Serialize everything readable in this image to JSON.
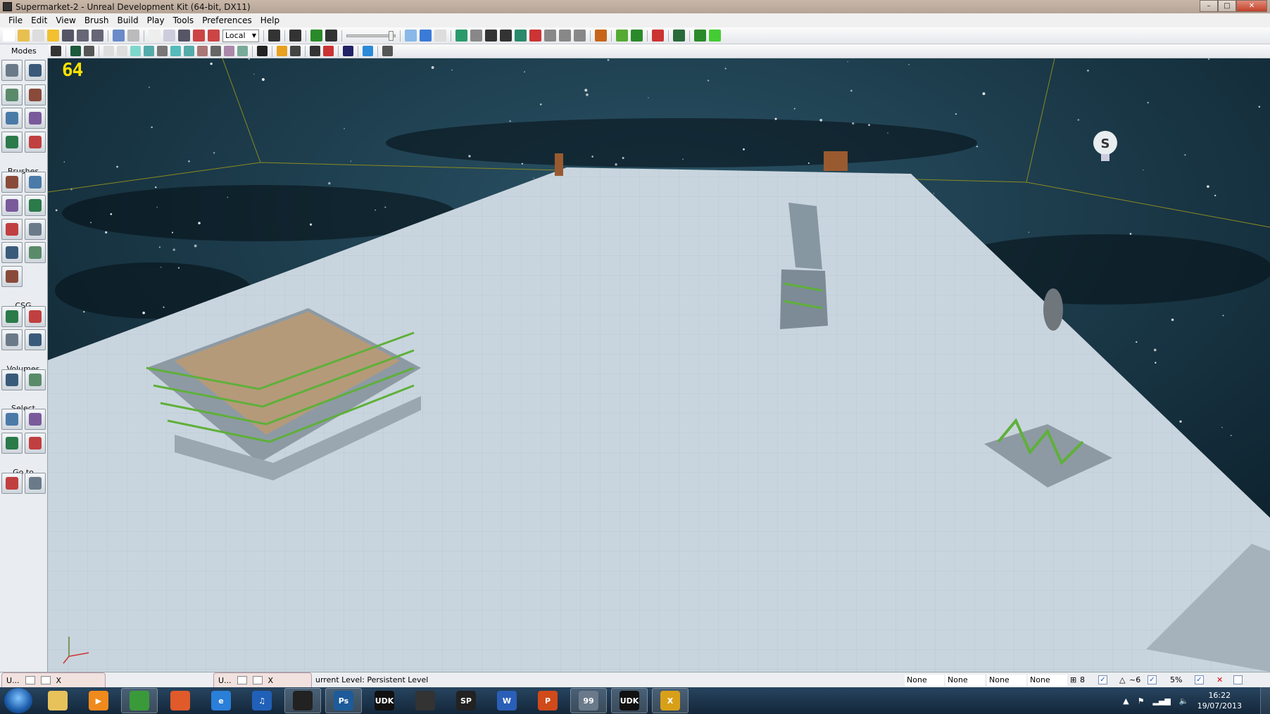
{
  "window": {
    "title": "Supermarket-2 - Unreal Development Kit (64-bit, DX11)",
    "controls": [
      "minimize",
      "maximize",
      "close"
    ]
  },
  "menu": [
    "File",
    "Edit",
    "View",
    "Brush",
    "Build",
    "Play",
    "Tools",
    "Preferences",
    "Help"
  ],
  "toolbar": {
    "coordinate_space": "Local"
  },
  "modes_panel": {
    "header": "Modes",
    "sections": [
      {
        "label": "Modes",
        "buttons": [
          "camera-mode",
          "geometry-mode",
          "terrain-mode",
          "texture-mode",
          "mesh-paint-mode",
          "actor-mode",
          "landscape-mode",
          "foliage-mode"
        ]
      },
      {
        "label": "Brushes",
        "buttons": [
          "cube-brush",
          "cone-brush",
          "stairs-brush",
          "cylinder-brush",
          "linear-stairs-brush",
          "sheet-brush",
          "spiral-stairs-brush",
          "sphere-brush",
          "volumetric-brush"
        ]
      },
      {
        "label": "CSG",
        "buttons": [
          "csg-add",
          "csg-subtract",
          "csg-intersect",
          "csg-deintersect"
        ]
      },
      {
        "label": "Volumes",
        "buttons": [
          "add-volume",
          "volume-shape"
        ]
      },
      {
        "label": "Select",
        "buttons": [
          "show-selected",
          "hide-selected",
          "select-invert",
          "show-all"
        ]
      },
      {
        "label": "Go to",
        "buttons": [
          "goto-actor",
          "goto-builder-brush"
        ]
      }
    ]
  },
  "viewport": {
    "fps": "64",
    "light_icon_label": "S",
    "sky_color": "#0d2430",
    "floor_color": "#c9d5de"
  },
  "statusbar": {
    "subwindows": [
      {
        "label": "U..."
      },
      {
        "label": "U..."
      }
    ],
    "current_level": "urrent Level:  Persistent Level",
    "fields": [
      "None",
      "None",
      "None",
      "None"
    ],
    "grid_size": "8",
    "rotation_snap": "~6",
    "scale_snap": "5%"
  },
  "taskbar": {
    "apps": [
      {
        "name": "explorer",
        "label": "",
        "color": "#e7c25a"
      },
      {
        "name": "media-player",
        "label": "▶",
        "color": "#f08a1c"
      },
      {
        "name": "chrome",
        "label": "",
        "color": "#3a9a3a"
      },
      {
        "name": "photo-gallery",
        "label": "",
        "color": "#e05a2a"
      },
      {
        "name": "internet-explorer",
        "label": "e",
        "color": "#2a7fd8"
      },
      {
        "name": "itunes",
        "label": "♫",
        "color": "#2160b8"
      },
      {
        "name": "app-dragon",
        "label": "",
        "color": "#222"
      },
      {
        "name": "photoshop",
        "label": "Ps",
        "color": "#1d5b9a"
      },
      {
        "name": "udk",
        "label": "UDK",
        "color": "#111"
      },
      {
        "name": "app-dragon-2",
        "label": "",
        "color": "#333"
      },
      {
        "name": "app-sp",
        "label": "SP",
        "color": "#222"
      },
      {
        "name": "word",
        "label": "W",
        "color": "#2a5fb8"
      },
      {
        "name": "powerpoint",
        "label": "P",
        "color": "#d04a1a"
      },
      {
        "name": "app-99",
        "label": "99",
        "color": "#6a7a8a"
      },
      {
        "name": "udk-2",
        "label": "UDK",
        "color": "#111"
      },
      {
        "name": "app-x",
        "label": "X",
        "color": "#d8a018"
      }
    ],
    "time": "16:22",
    "date": "19/07/2013"
  }
}
